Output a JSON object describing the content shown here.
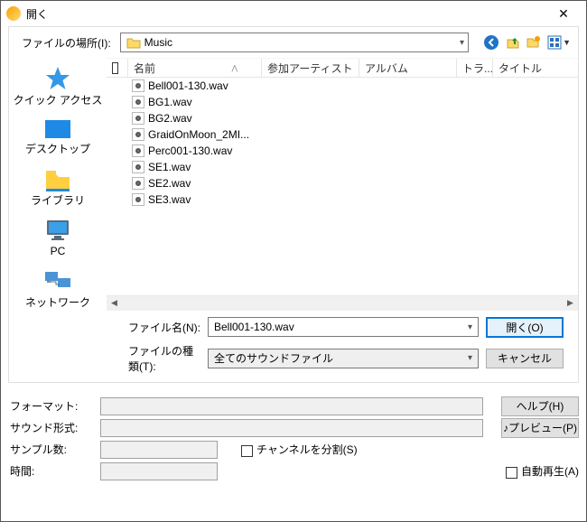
{
  "window": {
    "title": "開く"
  },
  "toolbar": {
    "location_label": "ファイルの場所(I):",
    "current_folder": "Music"
  },
  "columns": {
    "name": "名前",
    "artist": "参加アーティスト",
    "album": "アルバム",
    "track": "トラ...",
    "title": "タイトル"
  },
  "sidebar": [
    {
      "label": "クイック アクセス",
      "icon": "quick"
    },
    {
      "label": "デスクトップ",
      "icon": "desktop"
    },
    {
      "label": "ライブラリ",
      "icon": "libraries"
    },
    {
      "label": "PC",
      "icon": "pc"
    },
    {
      "label": "ネットワーク",
      "icon": "network"
    }
  ],
  "files": [
    "Bell001-130.wav",
    "BG1.wav",
    "BG2.wav",
    "GraidOnMoon_2MI...",
    "Perc001-130.wav",
    "SE1.wav",
    "SE2.wav",
    "SE3.wav"
  ],
  "filename": {
    "label": "ファイル名(N):",
    "value": "Bell001-130.wav"
  },
  "filetype": {
    "label": "ファイルの種類(T):",
    "value": "全てのサウンドファイル"
  },
  "buttons": {
    "open": "開く(O)",
    "cancel": "キャンセル",
    "help": "ヘルプ(H)",
    "preview": "♪プレビュー(P)"
  },
  "info": {
    "format": "フォーマット:",
    "soundtype": "サウンド形式:",
    "samples": "サンプル数:",
    "time": "時間:",
    "split": "チャンネルを分割(S)",
    "autoplay": "自動再生(A)"
  }
}
